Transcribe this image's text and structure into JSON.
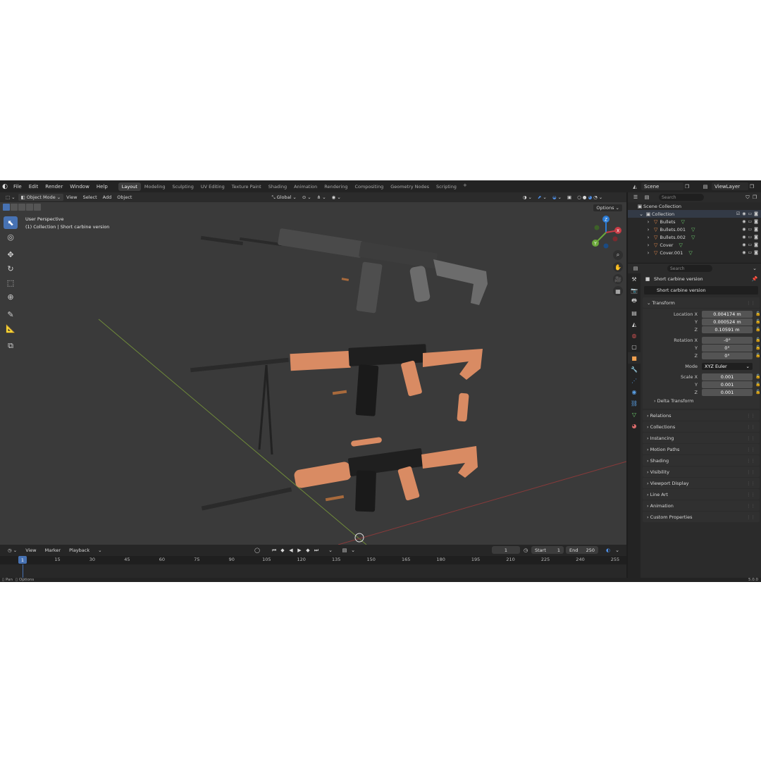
{
  "menu": [
    "File",
    "Edit",
    "Render",
    "Window",
    "Help"
  ],
  "workspaces": [
    {
      "label": "Layout",
      "active": true
    },
    {
      "label": "Modeling",
      "active": false
    },
    {
      "label": "Sculpting",
      "active": false
    },
    {
      "label": "UV Editing",
      "active": false
    },
    {
      "label": "Texture Paint",
      "active": false
    },
    {
      "label": "Shading",
      "active": false
    },
    {
      "label": "Animation",
      "active": false
    },
    {
      "label": "Rendering",
      "active": false
    },
    {
      "label": "Compositing",
      "active": false
    },
    {
      "label": "Geometry Nodes",
      "active": false
    },
    {
      "label": "Scripting",
      "active": false
    }
  ],
  "plus": "+",
  "scene": "Scene",
  "view_layer": "ViewLayer",
  "viewport": {
    "mode": "Object Mode",
    "menus": [
      "View",
      "Select",
      "Add",
      "Object"
    ],
    "transform_orientation": "Global",
    "options": "Options",
    "info_line1": "User Perspective",
    "info_line2": "(1) Collection | Short carbine version",
    "gizmo_labels": {
      "z": "Z",
      "y": "Y",
      "x": "X"
    }
  },
  "timeline": {
    "menus": [
      "View",
      "Marker",
      "Playback"
    ],
    "current_frame": "1",
    "start_label": "Start",
    "start": "1",
    "end_label": "End",
    "end": "250",
    "ticks": [
      "1",
      "15",
      "30",
      "45",
      "60",
      "75",
      "90",
      "105",
      "120",
      "135",
      "150",
      "165",
      "180",
      "195",
      "210",
      "225",
      "240",
      "255"
    ]
  },
  "statusbar": {
    "pan": "Pan",
    "options": "Options",
    "version": "5.0.0"
  },
  "outliner": {
    "search_placeholder": "Search",
    "root": "Scene Collection",
    "collection": "Collection",
    "items": [
      "Bullets",
      "Bullets.001",
      "Bullets.002",
      "Cover",
      "Cover.001"
    ]
  },
  "properties": {
    "search_placeholder": "Search",
    "object_name": "Short carbine version",
    "object_field": "Short carbine version",
    "transform": {
      "title": "Transform",
      "location_label": "Location X",
      "location": [
        "0.004174 m",
        "0.000524 m",
        "0.10591 m"
      ],
      "rotation_label": "Rotation X",
      "rotation": [
        "-0°",
        "0°",
        "0°"
      ],
      "mode_label": "Mode",
      "mode": "XYZ Euler",
      "scale_label": "Scale X",
      "scale": [
        "0.001",
        "0.001",
        "0.001"
      ],
      "y": "Y",
      "z": "Z",
      "delta": "Delta Transform"
    },
    "panels": [
      "Relations",
      "Collections",
      "Instancing",
      "Motion Paths",
      "Shading",
      "Visibility",
      "Viewport Display",
      "Line Art",
      "Animation",
      "Custom Properties"
    ]
  },
  "colors": {
    "accent": "#4772b3",
    "wood": "#d98b63",
    "metal": "#2a2a2a",
    "polymer": "#6e6e6e"
  }
}
